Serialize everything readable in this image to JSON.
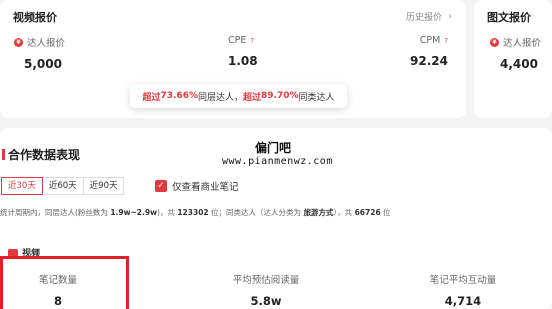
{
  "video_quote": {
    "title": "视频报价",
    "history_label": "历史报价",
    "metrics": [
      {
        "label": "达人报价",
        "value": "5,000"
      },
      {
        "label": "CPE",
        "value": "1.08"
      },
      {
        "label": "CPM",
        "value": "92.24"
      }
    ],
    "tooltip": {
      "prefix1": "超过",
      "pct1": "73.66%",
      "text1": "同层达人，",
      "prefix2": "超过",
      "pct2": "89.70%",
      "text2": "同类达人"
    }
  },
  "image_quote": {
    "title": "图文报价",
    "label": "达人报价",
    "value": "4,400"
  },
  "cooperation": {
    "title": "合作数据表现",
    "ranges": [
      "近30天",
      "近60天",
      "近90天"
    ],
    "active_range": "近30天",
    "checkbox_label": "仅查看商业笔记",
    "stats_text_1": "统计周期内，同层达人(粉丝数为 ",
    "stats_range": "1.9w~2.9w",
    "stats_text_2": ")，共 ",
    "stats_count1": "123302",
    "stats_text_3": " 位；同类达人（达人分类为 ",
    "stats_category": "旅游方式",
    "stats_text_4": "），共 ",
    "stats_count2": "66726",
    "stats_text_5": " 位",
    "video_label": "视频",
    "video_stats": [
      {
        "label": "笔记数量",
        "value": "8"
      },
      {
        "label": "平均预估阅读量",
        "value": "5.8w"
      },
      {
        "label": "笔记平均互动量",
        "value": "4,714"
      }
    ]
  },
  "watermark": {
    "title": "偏门吧",
    "url": "www.pianmenwz.com"
  },
  "colors": {
    "accent": "#e0393e",
    "highlight_border": "#e01f26"
  }
}
